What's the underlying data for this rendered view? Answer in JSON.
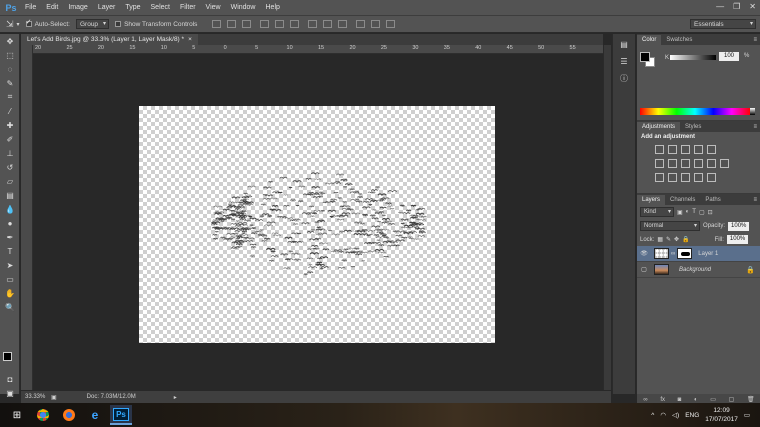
{
  "app": {
    "logo": "Ps"
  },
  "menu": [
    "File",
    "Edit",
    "Image",
    "Layer",
    "Type",
    "Select",
    "Filter",
    "View",
    "Window",
    "Help"
  ],
  "window_controls": {
    "minimize": "—",
    "maximize": "❐",
    "close": "✕"
  },
  "options": {
    "tool_icon": "move-tool-icon",
    "auto_select_label": "Auto-Select:",
    "auto_select_value": "Group",
    "show_transform_label": "Show Transform Controls",
    "workspace": "Essentials"
  },
  "document": {
    "tab_title": "Let's Add Birds.jpg @ 33.3% (Layer 1, Layer Mask/8) *",
    "tab_close": "×"
  },
  "ruler_top": [
    "20",
    "25",
    "20",
    "15",
    "10",
    "5",
    "0",
    "5",
    "10",
    "15",
    "20",
    "25",
    "30",
    "35",
    "40",
    "45",
    "50",
    "55"
  ],
  "status": {
    "zoom": "33.33%",
    "doc": "Doc: 7.03M/12.0M"
  },
  "panels": {
    "color": {
      "tab1": "Color",
      "tab2": "Swatches",
      "k_label": "K",
      "k_value": "100",
      "k_unit": "%"
    },
    "adjustments": {
      "tab1": "Adjustments",
      "tab2": "Styles",
      "title": "Add an adjustment"
    },
    "layers": {
      "tabs": [
        "Layers",
        "Channels",
        "Paths"
      ],
      "kind": "Kind",
      "blend_mode": "Normal",
      "opacity_label": "Opacity:",
      "opacity_value": "100%",
      "lock_label": "Lock:",
      "fill_label": "Fill:",
      "fill_value": "100%",
      "items": [
        {
          "name": "Layer 1",
          "selected": true,
          "visible": true
        },
        {
          "name": "Background",
          "selected": false,
          "visible": false,
          "locked": true
        }
      ]
    }
  },
  "taskbar": {
    "apps": [
      "windows-start-icon",
      "chrome-icon",
      "firefox-icon",
      "edge-icon",
      "photoshop-icon"
    ],
    "ps_label": "Ps",
    "lang": "ENG",
    "time": "12:09",
    "date": "17/07/2017"
  },
  "colors": {
    "menubar": "#535353",
    "canvas_bg": "#282828",
    "panel": "#535353",
    "selected_layer": "#5a6f8c"
  }
}
